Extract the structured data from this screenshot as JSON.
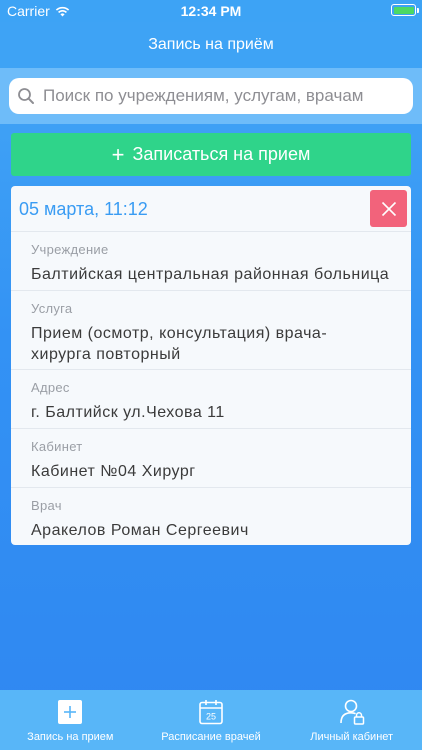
{
  "status_bar": {
    "carrier": "Carrier",
    "time": "12:34 PM",
    "battery_color": "#4cd964"
  },
  "nav": {
    "title": "Запись на приём"
  },
  "search": {
    "placeholder": "Поиск по учреждениям, услугам, врачам",
    "icon": "search-icon"
  },
  "book_button": {
    "icon": "plus-icon",
    "label": "Записаться на прием",
    "color": "#2fd48a"
  },
  "appointment": {
    "date": "05 марта, 11:12",
    "close_color": "#f2637b",
    "fields": [
      {
        "label": "Учреждение",
        "value": "Балтийская центральная районная больница"
      },
      {
        "label": "Услуга",
        "value": "Прием (осмотр, консультация) врача-хирурга повторный"
      },
      {
        "label": "Адрес",
        "value": "г. Балтийск ул.Чехова 11"
      },
      {
        "label": "Кабинет",
        "value": "Кабинет №04 Хирург"
      },
      {
        "label": "Врач",
        "value": "Аракелов Роман Сергеевич"
      }
    ]
  },
  "tabs": [
    {
      "label": "Запись на прием",
      "icon": "plus-square-icon",
      "active": true
    },
    {
      "label": "Расписание врачей",
      "icon": "calendar-icon",
      "calendar_day": "25"
    },
    {
      "label": "Личный кабинет",
      "icon": "user-lock-icon"
    }
  ]
}
